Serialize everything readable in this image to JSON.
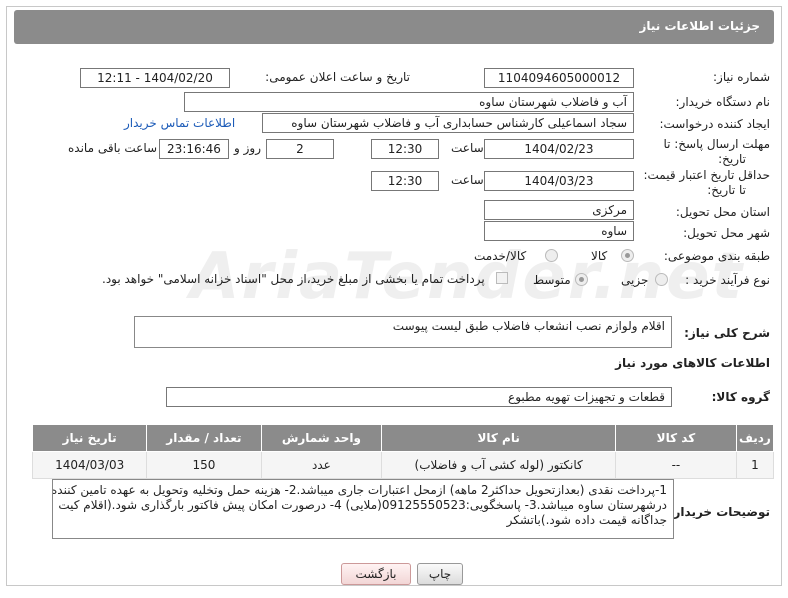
{
  "header": {
    "title": "جزئیات اطلاعات نیاز"
  },
  "fields": {
    "need_number_label": "شماره نیاز:",
    "need_number": "1104094605000012",
    "announce_label": "تاریخ و ساعت اعلان عمومی:",
    "announce_value": "1404/02/20 - 12:11",
    "buyer_org_label": "نام دستگاه خریدار:",
    "buyer_org": "آب و فاضلاب شهرستان ساوه",
    "creator_label": "ایجاد کننده درخواست:",
    "creator": "سجاد اسماعیلی کارشناس حسابداری آب و فاضلاب شهرستان ساوه",
    "contact_link": "اطلاعات تماس خریدار",
    "reply_deadline_label_1": "مهلت ارسال پاسخ: تا",
    "reply_deadline_label_2": "تاریخ:",
    "reply_date": "1404/02/23",
    "time_label": "ساعت",
    "reply_time": "12:30",
    "days_value": "2",
    "days_label": "روز و",
    "remaining_time": "23:16:46",
    "remaining_label": "ساعت باقی مانده",
    "validity_label_1": "حداقل تاریخ اعتبار قیمت:",
    "validity_label_2": "تا تاریخ:",
    "validity_date": "1404/03/23",
    "validity_time": "12:30",
    "province_label": "استان محل تحویل:",
    "province": "مرکزی",
    "city_label": "شهر محل تحویل:",
    "city": "ساوه",
    "category_label": "طبقه بندی موضوعی:",
    "category_options": [
      "کالا",
      "کالا/خدمت"
    ],
    "process_label": "نوع فرآیند خرید :",
    "process_options": [
      "جزیی",
      "متوسط"
    ],
    "payment_note": "پرداخت تمام یا بخشی از مبلغ خرید،از محل \"اسناد خزانه اسلامی\" خواهد بود.",
    "description_label": "شرح کلی نیاز:",
    "description": "اقلام ولوازم نصب انشعاب فاضلاب طبق لیست پیوست",
    "goods_info_title": "اطلاعات کالاهای مورد نیاز",
    "goods_group_label": "گروه کالا:",
    "goods_group": "قطعات و تجهیزات تهویه مطبوع"
  },
  "table": {
    "headers": [
      "ردیف",
      "کد کالا",
      "نام کالا",
      "واحد شمارش",
      "تعداد / مقدار",
      "تاریخ نیاز"
    ],
    "rows": [
      [
        "1",
        "--",
        "کانکتور (لوله کشی آب و فاضلاب)",
        "عدد",
        "150",
        "1404/03/03"
      ]
    ]
  },
  "buyer_notes": {
    "label": "توضیحات خریدار:",
    "lines": [
      "1-پرداخت  نقدی (بعدازتحویل حداکثر2 ماهه) ازمحل اعتبارات جاری میباشد.2- هزینه حمل وتخلیه وتحویل به عهده تامین کننده",
      "درشهرستان ساوه میباشد.3- پاسخگویی:09125550523(ملایی) 4- درصورت امکان پیش فاکتور بارگذاری شود.(اقلام کیت",
      "جداگانه قیمت داده شود.)باتشکر"
    ]
  },
  "buttons": {
    "print": "چاپ",
    "back": "بازگشت"
  },
  "watermark": "AriaTender.net"
}
